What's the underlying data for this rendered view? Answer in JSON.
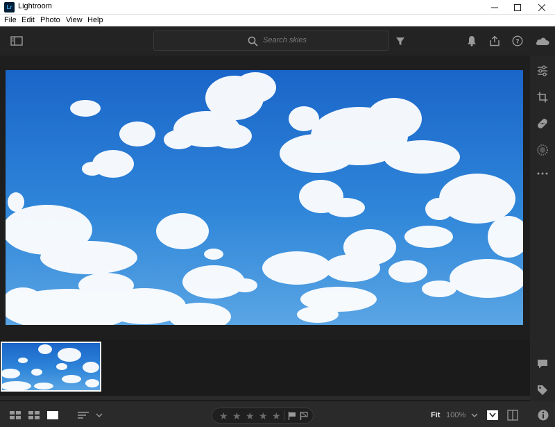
{
  "window": {
    "title": "Lightroom",
    "logo_text": "Lr"
  },
  "menu": {
    "items": [
      "File",
      "Edit",
      "Photo",
      "View",
      "Help"
    ]
  },
  "toolbar": {
    "search_placeholder": "Search skies"
  },
  "zoom": {
    "fit_label": "Fit",
    "percent_label": "100%"
  },
  "rating": {
    "stars": 0,
    "max_stars": 5
  },
  "icons": {
    "left": [
      "panel-toggle-icon"
    ],
    "right": [
      "bell-icon",
      "share-icon",
      "help-icon",
      "cloud-icon"
    ],
    "edit_panel": [
      "sliders-icon",
      "crop-icon",
      "healing-icon",
      "masking-icon",
      "more-icon"
    ],
    "edit_panel_bottom": [
      "comment-icon",
      "tag-icon",
      "info-icon"
    ]
  },
  "colors": {
    "accent": "#31a8ff",
    "sky": "#2e82d8"
  }
}
